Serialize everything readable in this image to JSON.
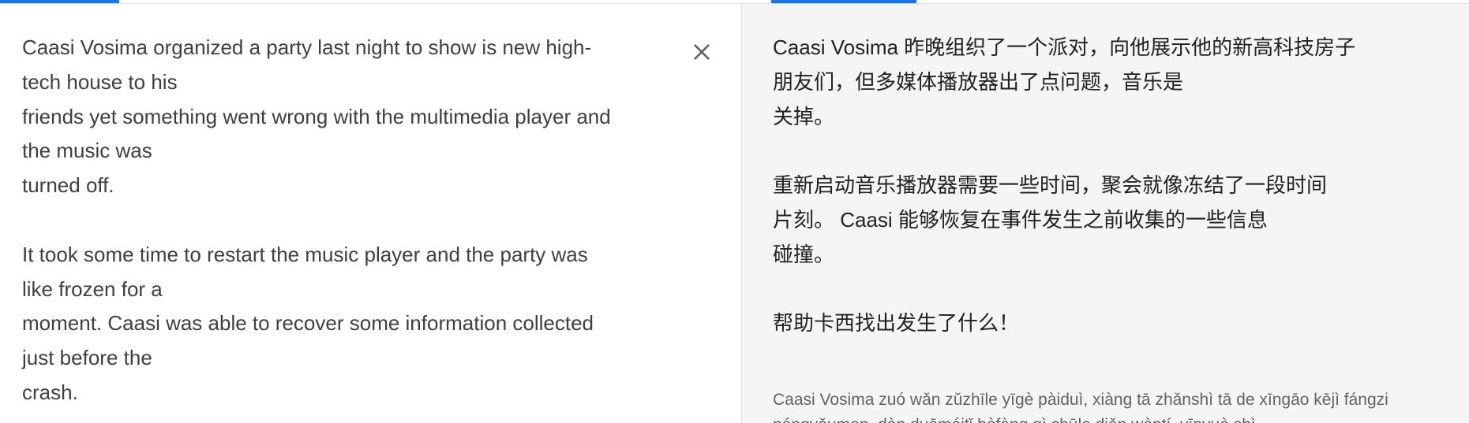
{
  "source": {
    "lines": [
      "Caasi Vosima organized a party last night to show is new high-",
      "tech house to his",
      "friends yet something went wrong with the multimedia player and",
      "the music was",
      "turned off.",
      "",
      "It took some time to restart the music player and the party was",
      "like frozen for a",
      "moment. Caasi was able to recover some information collected",
      "just before the",
      "crash."
    ],
    "clear_icon": "close-icon"
  },
  "target": {
    "lines": [
      "Caasi Vosima 昨晚组织了一个派对，向他展示他的新高科技房子",
      "朋友们，但多媒体播放器出了点问题，音乐是",
      "关掉。",
      "",
      "重新启动音乐播放器需要一些时间，聚会就像冻结了一段时间",
      "片刻。 Caasi 能够恢复在事件发生之前收集的一些信息",
      "碰撞。",
      "",
      "帮助卡西找出发生了什么！"
    ],
    "romanization": [
      "Caasi Vosima zuó wǎn zǔzhīle yīgè pàiduì, xiàng tā zhǎnshì tā de xīngāo kējì fángzi",
      "péngyǒumen, dàn duōméitǐ bòfàng qì chūle diǎn wèntí, yīnyuè shì"
    ]
  },
  "colors": {
    "accent": "#1a73e8",
    "source_text": "#3c4043",
    "target_text": "#202124",
    "target_background": "#f5f5f5",
    "romanization_text": "#5f6368"
  }
}
